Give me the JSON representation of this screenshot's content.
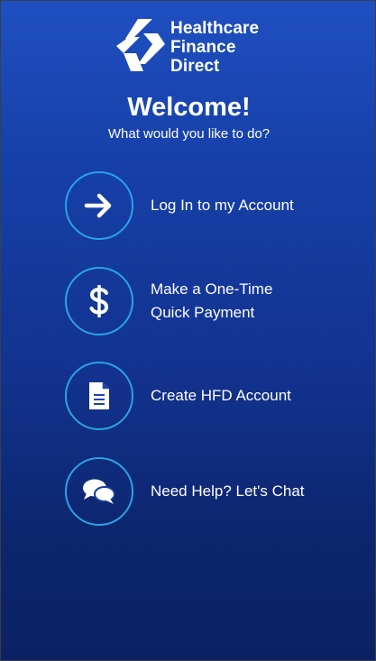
{
  "brand": {
    "line1": "Healthcare",
    "line2": "Finance",
    "line3": "Direct",
    "logo_icon": "hfd-logo-icon"
  },
  "welcome": {
    "title": "Welcome!",
    "subtitle": "What would you like to do?"
  },
  "options": [
    {
      "label": "Log In to my Account",
      "icon": "arrow-right-icon"
    },
    {
      "label": "Make a One-Time\nQuick Payment",
      "icon": "dollar-icon"
    },
    {
      "label": "Create HFD Account",
      "icon": "document-icon"
    },
    {
      "label": "Need Help? Let's Chat",
      "icon": "chat-bubbles-icon"
    }
  ],
  "colors": {
    "accent_ring": "#2aa3e6",
    "background_top": "#1f4fc1",
    "background_bottom": "#0b2163"
  }
}
